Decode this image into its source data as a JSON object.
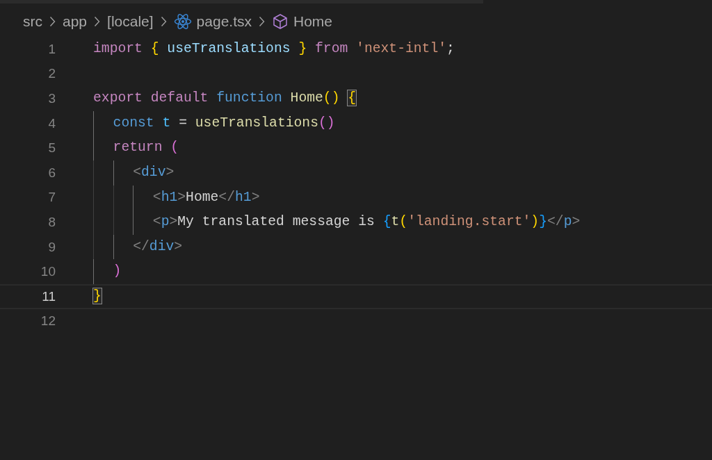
{
  "breadcrumbs": [
    {
      "kind": "folder",
      "label": "src"
    },
    {
      "kind": "folder",
      "label": "app"
    },
    {
      "kind": "folder",
      "label": "[locale]"
    },
    {
      "kind": "react-file",
      "label": "page.tsx"
    },
    {
      "kind": "symbol",
      "label": "Home"
    }
  ],
  "lines": [
    {
      "number": "1",
      "selected": false,
      "tokens": [
        {
          "kind": "control",
          "text": "import "
        },
        {
          "kind": "brace1",
          "text": "{ "
        },
        {
          "kind": "variable",
          "text": "useTranslations "
        },
        {
          "kind": "brace1",
          "text": "} "
        },
        {
          "kind": "control",
          "text": "from "
        },
        {
          "kind": "string",
          "text": "'next-intl'"
        },
        {
          "kind": "plain",
          "text": ";"
        }
      ]
    },
    {
      "number": "2",
      "selected": false
    },
    {
      "number": "3",
      "selected": false,
      "tokens": [
        {
          "kind": "control",
          "text": "export default "
        },
        {
          "kind": "storage",
          "text": "function "
        },
        {
          "kind": "function",
          "text": "Home"
        },
        {
          "kind": "brace1",
          "text": "() "
        },
        {
          "kind": "brace1",
          "text": "{",
          "matched": true
        }
      ]
    },
    {
      "number": "4",
      "selected": false,
      "tokens": [
        {
          "kind": "storage",
          "text": "  const "
        },
        {
          "kind": "constant",
          "text": "t"
        },
        {
          "kind": "plain",
          "text": " = "
        },
        {
          "kind": "function",
          "text": "useTranslations"
        },
        {
          "kind": "brace2",
          "text": "()"
        }
      ]
    },
    {
      "number": "5",
      "selected": false,
      "tokens": [
        {
          "kind": "control",
          "text": "  return "
        },
        {
          "kind": "brace2",
          "text": "("
        }
      ]
    },
    {
      "number": "6",
      "selected": false,
      "tokens": [
        {
          "kind": "tag-punct",
          "text": "    <"
        },
        {
          "kind": "tag",
          "text": "div"
        },
        {
          "kind": "tag-punct",
          "text": ">"
        }
      ]
    },
    {
      "number": "7",
      "selected": false,
      "tokens": [
        {
          "kind": "tag-punct",
          "text": "      <"
        },
        {
          "kind": "tag",
          "text": "h1"
        },
        {
          "kind": "tag-punct",
          "text": ">"
        },
        {
          "kind": "plain",
          "text": "Home"
        },
        {
          "kind": "tag-punct",
          "text": "</"
        },
        {
          "kind": "tag",
          "text": "h1"
        },
        {
          "kind": "tag-punct",
          "text": ">"
        }
      ]
    },
    {
      "number": "8",
      "selected": false,
      "tokens": [
        {
          "kind": "tag-punct",
          "text": "      <"
        },
        {
          "kind": "tag",
          "text": "p"
        },
        {
          "kind": "tag-punct",
          "text": ">"
        },
        {
          "kind": "plain",
          "text": "My translated message is "
        },
        {
          "kind": "brace3",
          "text": "{"
        },
        {
          "kind": "function",
          "text": "t"
        },
        {
          "kind": "brace1",
          "text": "("
        },
        {
          "kind": "string",
          "text": "'landing.start'"
        },
        {
          "kind": "brace1",
          "text": ")"
        },
        {
          "kind": "brace3",
          "text": "}"
        },
        {
          "kind": "tag-punct",
          "text": "</"
        },
        {
          "kind": "tag",
          "text": "p"
        },
        {
          "kind": "tag-punct",
          "text": ">"
        }
      ]
    },
    {
      "number": "9",
      "selected": false,
      "tokens": [
        {
          "kind": "tag-punct",
          "text": "    </"
        },
        {
          "kind": "tag",
          "text": "div"
        },
        {
          "kind": "tag-punct",
          "text": ">"
        }
      ]
    },
    {
      "number": "10",
      "selected": false,
      "tokens": [
        {
          "kind": "brace2",
          "text": "  )"
        }
      ]
    },
    {
      "number": "11",
      "selected": true,
      "tokens": [
        {
          "kind": "brace1",
          "text": "}",
          "matched": true
        }
      ]
    },
    {
      "number": "12",
      "selected": false
    }
  ]
}
